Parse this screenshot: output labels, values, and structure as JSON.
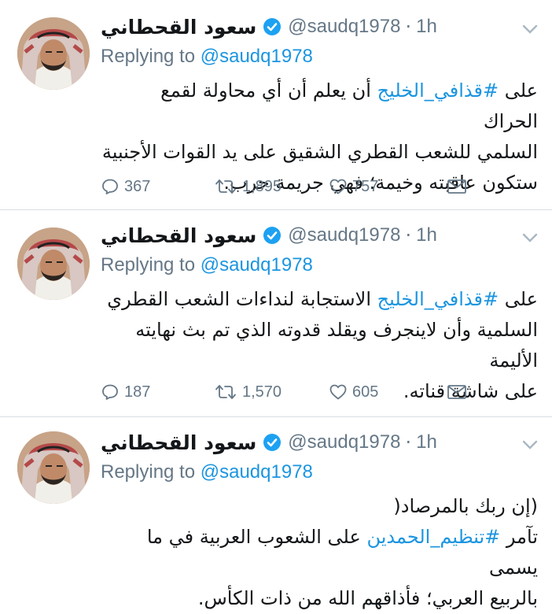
{
  "author": {
    "name": "سعود القحطاني",
    "handle": "@saudq1978",
    "time": "1h",
    "dot": "·"
  },
  "reply": {
    "prefix": "Replying to",
    "target": "@saudq1978"
  },
  "tweets": [
    {
      "lines": [
        {
          "pre": "على ",
          "hashtag": "#قذافي_الخليج",
          "post": " أن يعلم أن أي محاولة لقمع الحراك"
        },
        {
          "pre": "السلمي للشعب القطري الشقيق على يد القوات الأجنبية",
          "hashtag": "",
          "post": ""
        },
        {
          "pre": "ستكون عاقبته وخيمة؛ فهي جريمة حرب.",
          "hashtag": "",
          "post": ""
        }
      ],
      "replies": "367",
      "retweets": "1,895",
      "likes": "757"
    },
    {
      "lines": [
        {
          "pre": "على ",
          "hashtag": "#قذافي_الخليج",
          "post": " الاستجابة لنداءات الشعب القطري"
        },
        {
          "pre": "السلمية وأن لاينجرف ويقلد قدوته الذي تم بث نهايته الأليمة",
          "hashtag": "",
          "post": ""
        },
        {
          "pre": "على شاشة قناته.",
          "hashtag": "",
          "post": ""
        }
      ],
      "replies": "187",
      "retweets": "1,570",
      "likes": "605"
    },
    {
      "lines": [
        {
          "pre": "(إن ربك بالمرصاد(",
          "hashtag": "",
          "post": ""
        },
        {
          "pre": "تآمر ",
          "hashtag": "#تنظيم_الحمدين",
          "post": " على الشعوب العربية في ما يسمى"
        },
        {
          "pre": "بالربيع العربي؛ فأذاقهم الله من ذات الكأس.",
          "hashtag": "",
          "post": ""
        }
      ]
    }
  ],
  "colors": {
    "link": "#1b95e0",
    "muted": "#657786",
    "text": "#14171a",
    "divider": "#d8dde1",
    "verified": "#1da1f2"
  },
  "icons": [
    "verified-badge-icon",
    "chevron-down-icon",
    "reply-icon",
    "retweet-icon",
    "like-icon",
    "direct-message-icon",
    "avatar-photo"
  ]
}
